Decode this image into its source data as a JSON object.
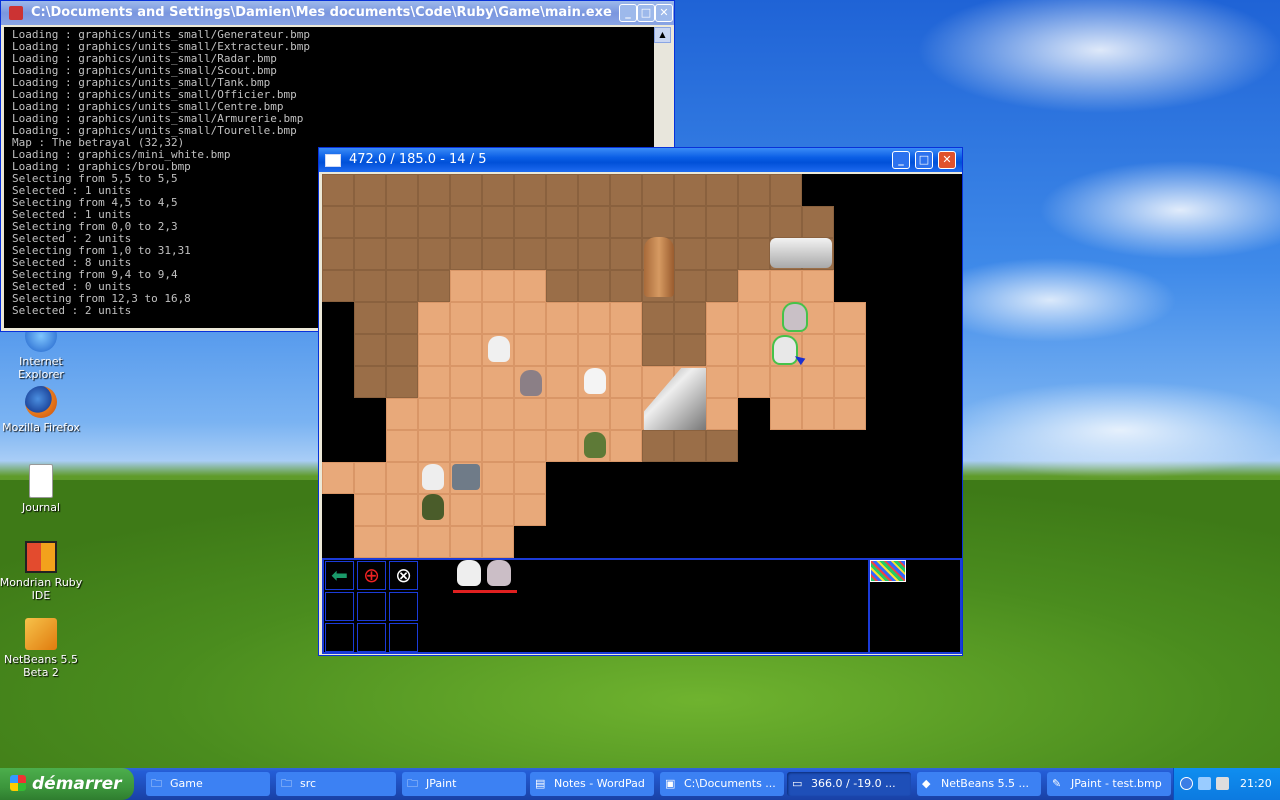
{
  "desktop": {
    "icons": [
      {
        "label": "Internet Explorer",
        "icon": "internet-explorer-icon"
      },
      {
        "label": "Mozilla Firefox",
        "icon": "firefox-icon"
      },
      {
        "label": "Journal",
        "icon": "journal-icon"
      },
      {
        "label": "Mondrian Ruby IDE",
        "icon": "mondrian-icon"
      },
      {
        "label": "NetBeans 5.5 Beta 2",
        "icon": "netbeans-icon"
      }
    ]
  },
  "console_window": {
    "title": "C:\\Documents and Settings\\Damien\\Mes documents\\Code\\Ruby\\Game\\main.exe",
    "lines": [
      "Loading : graphics/units_small/Generateur.bmp",
      "Loading : graphics/units_small/Extracteur.bmp",
      "Loading : graphics/units_small/Radar.bmp",
      "Loading : graphics/units_small/Scout.bmp",
      "Loading : graphics/units_small/Tank.bmp",
      "Loading : graphics/units_small/Officier.bmp",
      "Loading : graphics/units_small/Centre.bmp",
      "Loading : graphics/units_small/Armurerie.bmp",
      "Loading : graphics/units_small/Tourelle.bmp",
      "Map : The betrayal (32,32)",
      "Loading : graphics/mini_white.bmp",
      "Loading : graphics/brou.bmp",
      "Selecting from 5,5 to 5,5",
      "Selected : 1 units",
      "Selecting from 4,5 to 4,5",
      "Selected : 1 units",
      "Selecting from 0,0 to 2,3",
      "Selected : 2 units",
      "Selecting from 1,0 to 31,31",
      "Selected : 8 units",
      "Selecting from 9,4 to 9,4",
      "Selected : 0 units",
      "Selecting from 12,3 to 16,8",
      "Selected : 2 units"
    ]
  },
  "game_window": {
    "title": "472.0 / 185.0 - 14 / 5"
  },
  "taskbar": {
    "start_label": "démarrer",
    "tasks": [
      {
        "label": "Game",
        "icon": "folder-icon"
      },
      {
        "label": "src",
        "icon": "folder-icon"
      },
      {
        "label": "JPaint",
        "icon": "folder-icon"
      },
      {
        "label": "Notes - WordPad",
        "icon": "wordpad-icon"
      },
      {
        "label": "C:\\Documents ...",
        "icon": "console-icon"
      },
      {
        "label": "366.0 / -19.0 ...",
        "icon": "game-window-icon"
      },
      {
        "label": "NetBeans 5.5 ...",
        "icon": "netbeans-icon"
      },
      {
        "label": "JPaint - test.bmp",
        "icon": "jpaint-icon"
      }
    ],
    "clock": "21:20"
  }
}
